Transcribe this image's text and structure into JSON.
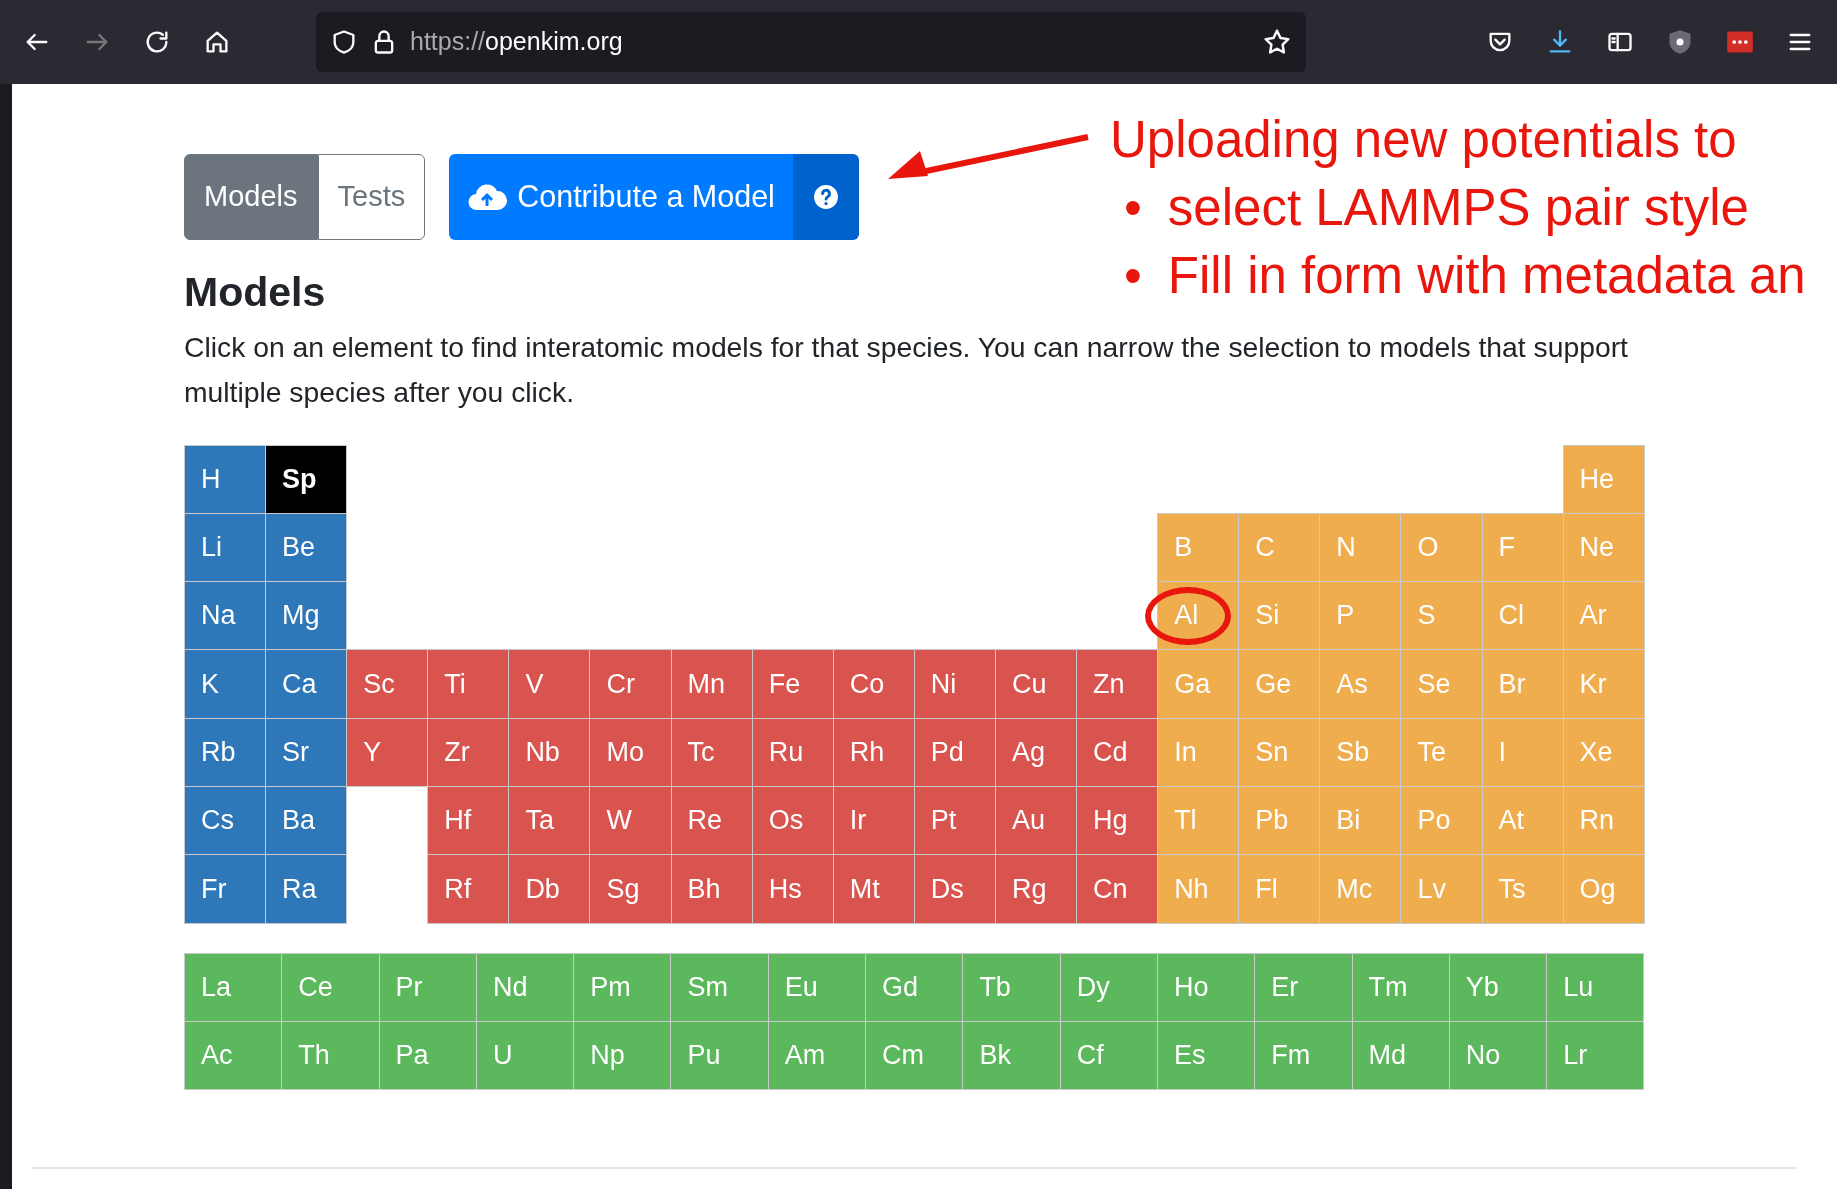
{
  "browser": {
    "url_scheme": "https://",
    "url_host": "openkim.org",
    "back_disabled": false,
    "forward_disabled": true
  },
  "view_tabs": [
    {
      "label": "Models",
      "selected": true
    },
    {
      "label": "Tests",
      "selected": false
    }
  ],
  "contribute_button": {
    "label": "Contribute a Model"
  },
  "heading": "Models",
  "intro": "Click on an element to find interatomic models for that species. You can narrow the selection to models that support multiple species after you click.",
  "annotation": {
    "title": "Uploading new potentials to",
    "bullets": [
      {
        "marker": "•",
        "text": "select LAMMPS pair style"
      },
      {
        "marker": "•",
        "text": "Fill in form with metadata an"
      }
    ]
  },
  "periodic_table": {
    "rows": [
      [
        {
          "symbol": "H",
          "kind": "s"
        },
        {
          "symbol": "Sp",
          "kind": "special"
        },
        {
          "kind": "gap"
        },
        {
          "kind": "gap"
        },
        {
          "kind": "gap"
        },
        {
          "kind": "gap"
        },
        {
          "kind": "gap"
        },
        {
          "kind": "gap"
        },
        {
          "kind": "gap"
        },
        {
          "kind": "gap"
        },
        {
          "kind": "gap"
        },
        {
          "kind": "gap"
        },
        {
          "kind": "gap"
        },
        {
          "kind": "gap"
        },
        {
          "kind": "gap"
        },
        {
          "kind": "gap"
        },
        {
          "kind": "gap"
        },
        {
          "symbol": "He",
          "kind": "p"
        }
      ],
      [
        {
          "symbol": "Li",
          "kind": "s"
        },
        {
          "symbol": "Be",
          "kind": "s"
        },
        {
          "kind": "gap"
        },
        {
          "kind": "gap"
        },
        {
          "kind": "gap"
        },
        {
          "kind": "gap"
        },
        {
          "kind": "gap"
        },
        {
          "kind": "gap"
        },
        {
          "kind": "gap"
        },
        {
          "kind": "gap"
        },
        {
          "kind": "gap"
        },
        {
          "kind": "gap"
        },
        {
          "symbol": "B",
          "kind": "p"
        },
        {
          "symbol": "C",
          "kind": "p"
        },
        {
          "symbol": "N",
          "kind": "p"
        },
        {
          "symbol": "O",
          "kind": "p"
        },
        {
          "symbol": "F",
          "kind": "p"
        },
        {
          "symbol": "Ne",
          "kind": "p"
        }
      ],
      [
        {
          "symbol": "Na",
          "kind": "s"
        },
        {
          "symbol": "Mg",
          "kind": "s"
        },
        {
          "kind": "gap"
        },
        {
          "kind": "gap"
        },
        {
          "kind": "gap"
        },
        {
          "kind": "gap"
        },
        {
          "kind": "gap"
        },
        {
          "kind": "gap"
        },
        {
          "kind": "gap"
        },
        {
          "kind": "gap"
        },
        {
          "kind": "gap"
        },
        {
          "kind": "gap"
        },
        {
          "symbol": "Al",
          "kind": "p",
          "circled": true
        },
        {
          "symbol": "Si",
          "kind": "p"
        },
        {
          "symbol": "P",
          "kind": "p"
        },
        {
          "symbol": "S",
          "kind": "p"
        },
        {
          "symbol": "Cl",
          "kind": "p"
        },
        {
          "symbol": "Ar",
          "kind": "p"
        }
      ],
      [
        {
          "symbol": "K",
          "kind": "s"
        },
        {
          "symbol": "Ca",
          "kind": "s"
        },
        {
          "symbol": "Sc",
          "kind": "d"
        },
        {
          "symbol": "Ti",
          "kind": "d"
        },
        {
          "symbol": "V",
          "kind": "d"
        },
        {
          "symbol": "Cr",
          "kind": "d"
        },
        {
          "symbol": "Mn",
          "kind": "d"
        },
        {
          "symbol": "Fe",
          "kind": "d"
        },
        {
          "symbol": "Co",
          "kind": "d"
        },
        {
          "symbol": "Ni",
          "kind": "d"
        },
        {
          "symbol": "Cu",
          "kind": "d"
        },
        {
          "symbol": "Zn",
          "kind": "d"
        },
        {
          "symbol": "Ga",
          "kind": "p"
        },
        {
          "symbol": "Ge",
          "kind": "p"
        },
        {
          "symbol": "As",
          "kind": "p"
        },
        {
          "symbol": "Se",
          "kind": "p"
        },
        {
          "symbol": "Br",
          "kind": "p"
        },
        {
          "symbol": "Kr",
          "kind": "p"
        }
      ],
      [
        {
          "symbol": "Rb",
          "kind": "s"
        },
        {
          "symbol": "Sr",
          "kind": "s"
        },
        {
          "symbol": "Y",
          "kind": "d"
        },
        {
          "symbol": "Zr",
          "kind": "d"
        },
        {
          "symbol": "Nb",
          "kind": "d"
        },
        {
          "symbol": "Mo",
          "kind": "d"
        },
        {
          "symbol": "Tc",
          "kind": "d"
        },
        {
          "symbol": "Ru",
          "kind": "d"
        },
        {
          "symbol": "Rh",
          "kind": "d"
        },
        {
          "symbol": "Pd",
          "kind": "d"
        },
        {
          "symbol": "Ag",
          "kind": "d"
        },
        {
          "symbol": "Cd",
          "kind": "d"
        },
        {
          "symbol": "In",
          "kind": "p"
        },
        {
          "symbol": "Sn",
          "kind": "p"
        },
        {
          "symbol": "Sb",
          "kind": "p"
        },
        {
          "symbol": "Te",
          "kind": "p"
        },
        {
          "symbol": "I",
          "kind": "p"
        },
        {
          "symbol": "Xe",
          "kind": "p"
        }
      ],
      [
        {
          "symbol": "Cs",
          "kind": "s"
        },
        {
          "symbol": "Ba",
          "kind": "s"
        },
        {
          "kind": "gap"
        },
        {
          "symbol": "Hf",
          "kind": "d"
        },
        {
          "symbol": "Ta",
          "kind": "d"
        },
        {
          "symbol": "W",
          "kind": "d"
        },
        {
          "symbol": "Re",
          "kind": "d"
        },
        {
          "symbol": "Os",
          "kind": "d"
        },
        {
          "symbol": "Ir",
          "kind": "d"
        },
        {
          "symbol": "Pt",
          "kind": "d"
        },
        {
          "symbol": "Au",
          "kind": "d"
        },
        {
          "symbol": "Hg",
          "kind": "d"
        },
        {
          "symbol": "Tl",
          "kind": "p"
        },
        {
          "symbol": "Pb",
          "kind": "p"
        },
        {
          "symbol": "Bi",
          "kind": "p"
        },
        {
          "symbol": "Po",
          "kind": "p"
        },
        {
          "symbol": "At",
          "kind": "p"
        },
        {
          "symbol": "Rn",
          "kind": "p"
        }
      ],
      [
        {
          "symbol": "Fr",
          "kind": "s"
        },
        {
          "symbol": "Ra",
          "kind": "s"
        },
        {
          "kind": "gap"
        },
        {
          "symbol": "Rf",
          "kind": "d"
        },
        {
          "symbol": "Db",
          "kind": "d"
        },
        {
          "symbol": "Sg",
          "kind": "d"
        },
        {
          "symbol": "Bh",
          "kind": "d"
        },
        {
          "symbol": "Hs",
          "kind": "d"
        },
        {
          "symbol": "Mt",
          "kind": "d"
        },
        {
          "symbol": "Ds",
          "kind": "d"
        },
        {
          "symbol": "Rg",
          "kind": "d"
        },
        {
          "symbol": "Cn",
          "kind": "d"
        },
        {
          "symbol": "Nh",
          "kind": "p"
        },
        {
          "symbol": "Fl",
          "kind": "p"
        },
        {
          "symbol": "Mc",
          "kind": "p"
        },
        {
          "symbol": "Lv",
          "kind": "p"
        },
        {
          "symbol": "Ts",
          "kind": "p"
        },
        {
          "symbol": "Og",
          "kind": "p"
        }
      ]
    ],
    "f_block": [
      [
        {
          "symbol": "La",
          "kind": "f"
        },
        {
          "symbol": "Ce",
          "kind": "f"
        },
        {
          "symbol": "Pr",
          "kind": "f"
        },
        {
          "symbol": "Nd",
          "kind": "f"
        },
        {
          "symbol": "Pm",
          "kind": "f"
        },
        {
          "symbol": "Sm",
          "kind": "f"
        },
        {
          "symbol": "Eu",
          "kind": "f"
        },
        {
          "symbol": "Gd",
          "kind": "f"
        },
        {
          "symbol": "Tb",
          "kind": "f"
        },
        {
          "symbol": "Dy",
          "kind": "f"
        },
        {
          "symbol": "Ho",
          "kind": "f"
        },
        {
          "symbol": "Er",
          "kind": "f"
        },
        {
          "symbol": "Tm",
          "kind": "f"
        },
        {
          "symbol": "Yb",
          "kind": "f"
        },
        {
          "symbol": "Lu",
          "kind": "f"
        }
      ],
      [
        {
          "symbol": "Ac",
          "kind": "f"
        },
        {
          "symbol": "Th",
          "kind": "f"
        },
        {
          "symbol": "Pa",
          "kind": "f"
        },
        {
          "symbol": "U",
          "kind": "f"
        },
        {
          "symbol": "Np",
          "kind": "f"
        },
        {
          "symbol": "Pu",
          "kind": "f"
        },
        {
          "symbol": "Am",
          "kind": "f"
        },
        {
          "symbol": "Cm",
          "kind": "f"
        },
        {
          "symbol": "Bk",
          "kind": "f"
        },
        {
          "symbol": "Cf",
          "kind": "f"
        },
        {
          "symbol": "Es",
          "kind": "f"
        },
        {
          "symbol": "Fm",
          "kind": "f"
        },
        {
          "symbol": "Md",
          "kind": "f"
        },
        {
          "symbol": "No",
          "kind": "f"
        },
        {
          "symbol": "Lr",
          "kind": "f"
        }
      ]
    ]
  }
}
